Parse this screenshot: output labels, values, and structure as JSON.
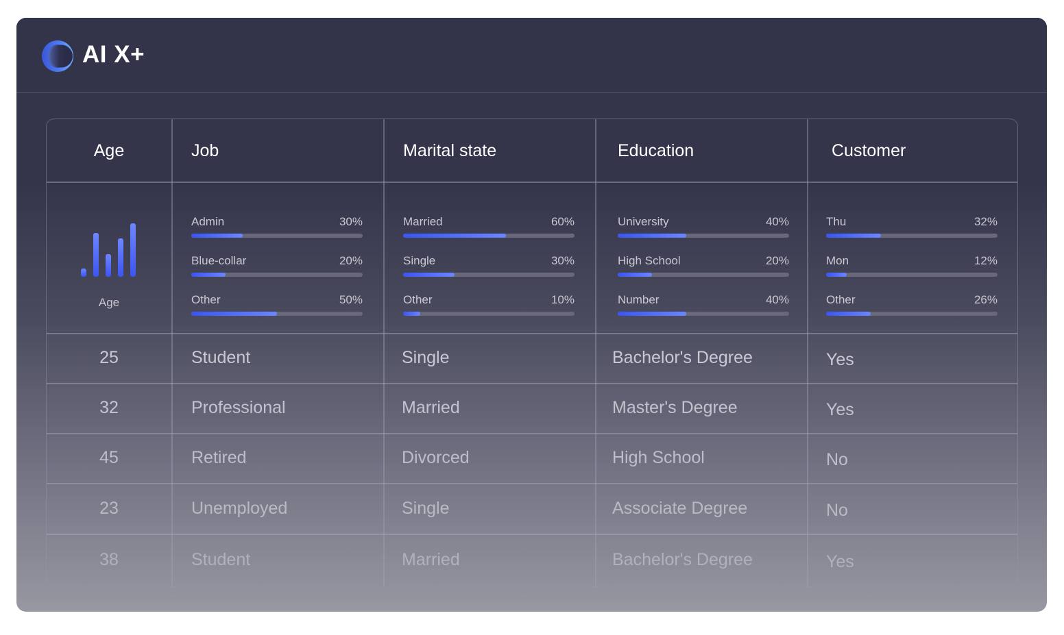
{
  "app": {
    "name": "AI X+",
    "logo_icon": "ring-logo-icon"
  },
  "table": {
    "columns": [
      "Age",
      "Job",
      "Marital state",
      "Education",
      "Customer"
    ],
    "summary": {
      "age": {
        "label": "Age",
        "histogram_relative": [
          0.15,
          0.82,
          0.42,
          0.72,
          1.0
        ]
      },
      "job": [
        {
          "label": "Admin",
          "pct_text": "30%",
          "value": 30
        },
        {
          "label": "Blue-collar",
          "pct_text": "20%",
          "value": 20
        },
        {
          "label": "Other",
          "pct_text": "50%",
          "value": 50
        }
      ],
      "marital": [
        {
          "label": "Married",
          "pct_text": "60%",
          "value": 60
        },
        {
          "label": "Single",
          "pct_text": "30%",
          "value": 30
        },
        {
          "label": "Other",
          "pct_text": "10%",
          "value": 10
        }
      ],
      "education": [
        {
          "label": "University",
          "pct_text": "40%",
          "value": 40
        },
        {
          "label": "High School",
          "pct_text": "20%",
          "value": 20
        },
        {
          "label": "Number",
          "pct_text": "40%",
          "value": 40
        }
      ],
      "customer": [
        {
          "label": "Thu",
          "pct_text": "32%",
          "value": 32
        },
        {
          "label": "Mon",
          "pct_text": "12%",
          "value": 12
        },
        {
          "label": "Other",
          "pct_text": "26%",
          "value": 26
        }
      ]
    },
    "rows": [
      [
        "25",
        "Student",
        "Single",
        "Bachelor's Degree",
        "Yes"
      ],
      [
        "32",
        "Professional",
        "Married",
        "Master's Degree",
        "Yes"
      ],
      [
        "45",
        "Retired",
        "Divorced",
        "High School",
        "No"
      ],
      [
        "23",
        "Unemployed",
        "Single",
        "Associate Degree",
        "No"
      ],
      [
        "38",
        "Student",
        "Married",
        "Bachelor's Degree",
        "Yes"
      ]
    ]
  },
  "colors": {
    "accent": "#3b55f2",
    "accent_light": "#6a86ff",
    "track": "#68687a",
    "panel": "#33344a"
  }
}
